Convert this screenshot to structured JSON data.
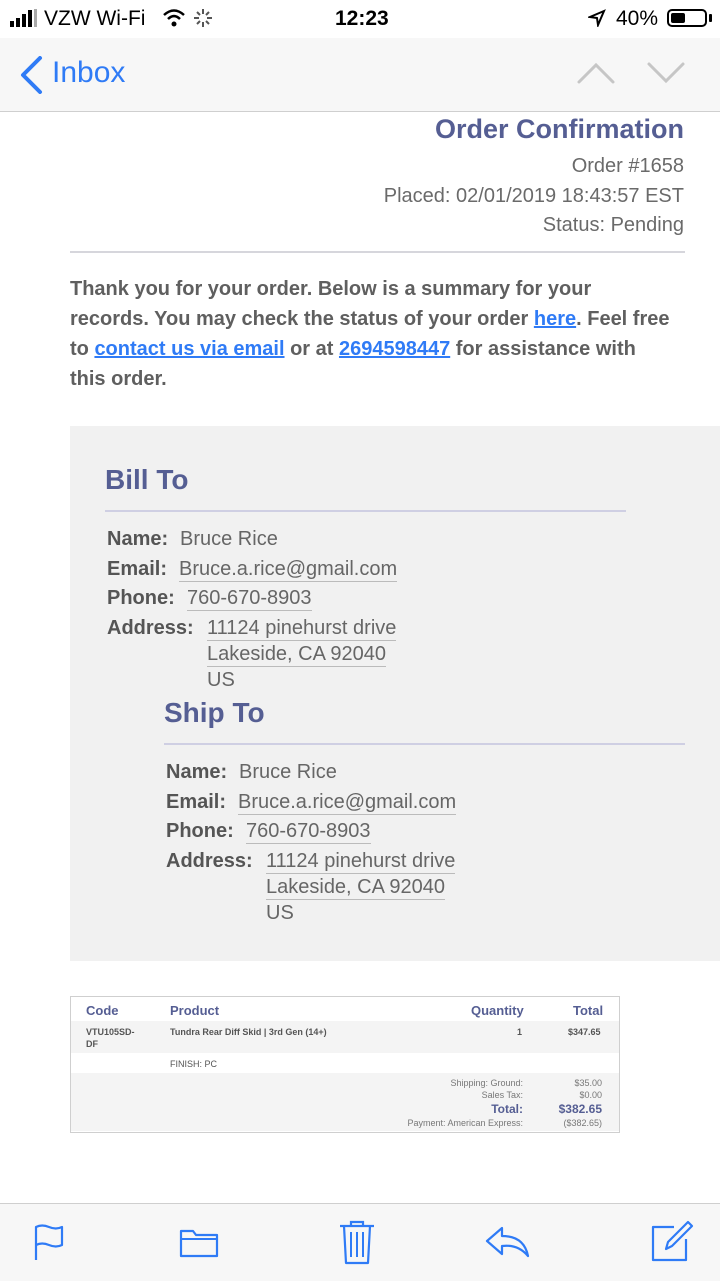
{
  "status_bar": {
    "carrier": "VZW Wi-Fi",
    "time": "12:23",
    "battery": "40%"
  },
  "nav": {
    "back_label": "Inbox"
  },
  "header": {
    "title": "Order Confirmation",
    "order_no": "Order #1658",
    "placed": "Placed: 02/01/2019 18:43:57 EST",
    "status": "Status: Pending"
  },
  "intro": {
    "text1": "Thank you for your order. Below is a summary for your records. You may check the status of your order ",
    "link_here": "here",
    "text2": ". Feel free to ",
    "link_contact": "contact us via email",
    "text3": " or at ",
    "link_phone": "2694598447",
    "text4": " for assistance with this order."
  },
  "bill_to": {
    "title": "Bill To",
    "name_label": "Name:",
    "name": "Bruce Rice",
    "email_label": "Email:",
    "email": "Bruce.a.rice@gmail.com",
    "phone_label": "Phone:",
    "phone": "760-670-8903",
    "address_label": "Address:",
    "address1": "11124 pinehurst drive",
    "address2": "Lakeside, CA 92040",
    "country": "US"
  },
  "ship_to": {
    "title": "Ship To",
    "name_label": "Name:",
    "name": "Bruce Rice",
    "email_label": "Email:",
    "email": "Bruce.a.rice@gmail.com",
    "phone_label": "Phone:",
    "phone": "760-670-8903",
    "address_label": "Address:",
    "address1": "11124 pinehurst drive",
    "address2": "Lakeside, CA 92040",
    "country": "US"
  },
  "order_table": {
    "headers": {
      "code": "Code",
      "product": "Product",
      "quantity": "Quantity",
      "total": "Total"
    },
    "row": {
      "code_line1": "VTU105SD-",
      "code_line2": "DF",
      "product": "Tundra Rear Diff Skid | 3rd Gen (14+)",
      "quantity": "1",
      "total": "$347.65"
    },
    "finish": "FINISH: PC",
    "shipping_label": "Shipping: Ground:",
    "shipping": "$35.00",
    "tax_label": "Sales Tax:",
    "tax": "$0.00",
    "total_label": "Total:",
    "total": "$382.65",
    "payment_label": "Payment: American Express:",
    "payment": "($382.65)"
  },
  "colors": {
    "accent": "#2f7bf6",
    "heading": "#555e93"
  },
  "toolbar": {
    "icons": [
      "flag-icon",
      "folder-icon",
      "trash-icon",
      "reply-icon",
      "compose-icon"
    ]
  }
}
